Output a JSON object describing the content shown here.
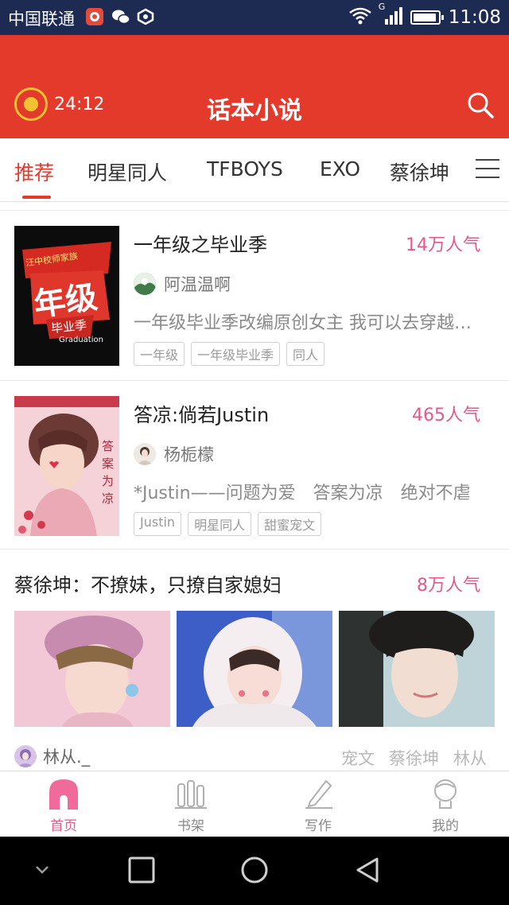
{
  "status_bar": {
    "carrier": "中国联通",
    "network": "G",
    "time": "11:08",
    "icons": [
      "music-app-icon",
      "wechat-icon",
      "shield-app-icon",
      "wifi-icon",
      "signal-icon",
      "battery-icon"
    ]
  },
  "header": {
    "timer": "24:12",
    "title": "话本小说",
    "icons": [
      "alarm-coin-icon",
      "search-icon"
    ]
  },
  "tabs": [
    {
      "label": "推荐",
      "active": true
    },
    {
      "label": "明星同人",
      "active": false
    },
    {
      "label": "TFBOYS",
      "active": false
    },
    {
      "label": "EXO",
      "active": false
    },
    {
      "label": "蔡徐坤",
      "active": false
    }
  ],
  "books": [
    {
      "title": "一年级之毕业季",
      "popularity": "14万人气",
      "author": "阿温温啊",
      "description": "一年级毕业季改编原创女主 我可以去穿越时空",
      "tags": [
        "一年级",
        "一年级毕业季",
        "同人"
      ],
      "cover_text": {
        "top": "汪中校师家族",
        "main": "年级",
        "sub": "毕业季",
        "en": "Graduation"
      }
    },
    {
      "title": "答凉:倘若Justin",
      "popularity": "465人气",
      "author": "杨栀檬",
      "description": "*Justin——问题为爱　答案为凉　绝对不虐",
      "tags": [
        "Justin",
        "明星同人",
        "甜蜜宠文"
      ],
      "cover_text": {
        "side": "答案为凉"
      }
    }
  ],
  "featured": {
    "title": "蔡徐坤：不撩妹，只撩自家媳妇",
    "popularity": "8万人气",
    "author": "林从._",
    "tags": [
      "宠文",
      "蔡徐坤",
      "林从"
    ]
  },
  "bottom_nav": [
    {
      "label": "首页",
      "icon": "home-icon",
      "active": true
    },
    {
      "label": "书架",
      "icon": "bookshelf-icon",
      "active": false
    },
    {
      "label": "写作",
      "icon": "pen-icon",
      "active": false
    },
    {
      "label": "我的",
      "icon": "profile-icon",
      "active": false
    }
  ],
  "colors": {
    "brand_red": "#e33a2c",
    "popularity_pink": "#e2598a",
    "status_bar": "#1d2a52"
  }
}
